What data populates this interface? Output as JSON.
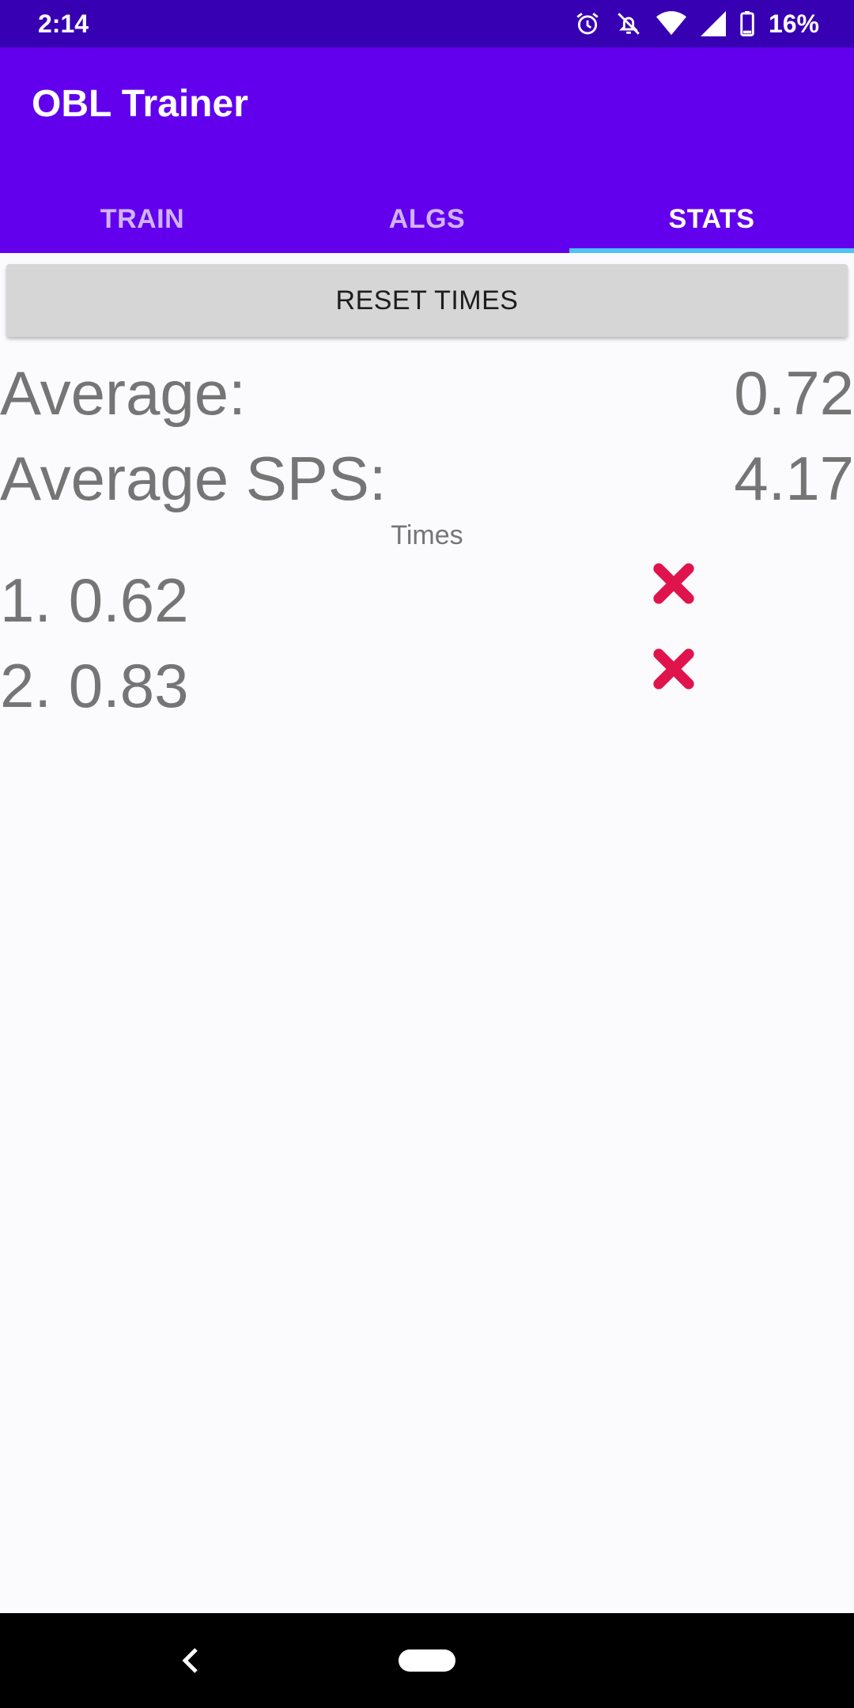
{
  "status_bar": {
    "time": "2:14",
    "battery": "16%",
    "icons": [
      "alarm-icon",
      "notifications-off-icon",
      "wifi-icon",
      "signal-icon",
      "battery-icon"
    ]
  },
  "app": {
    "title": "OBL Trainer"
  },
  "tabs": [
    {
      "label": "TRAIN",
      "active": false
    },
    {
      "label": "ALGS",
      "active": false
    },
    {
      "label": "STATS",
      "active": true
    }
  ],
  "stats": {
    "reset_label": "RESET TIMES",
    "average_label": "Average:",
    "average_value": "0.72",
    "sps_label": "Average SPS:",
    "sps_value": "4.17",
    "times_heading": "Times",
    "times": [
      "1. 0.62",
      "2. 0.83"
    ]
  },
  "colors": {
    "status_bar": "#3700b3",
    "app_bar": "#6200ee",
    "tab_indicator": "#4fc3f7",
    "delete_icon": "#e0144c",
    "text_gray": "#757575"
  },
  "nav": {
    "icons": [
      "back-icon",
      "home-pill-icon"
    ]
  }
}
